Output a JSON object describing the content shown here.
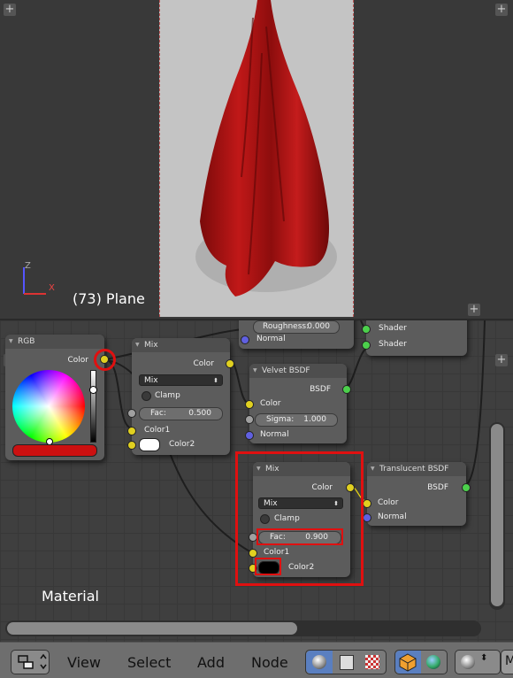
{
  "viewport": {
    "object_label": "(73) Plane",
    "axis_z": "Z",
    "axis_x": "X"
  },
  "node_editor": {
    "editor_label": "Material",
    "partial_node": {
      "roughness_label": "Roughness:",
      "roughness_value": "0.000",
      "normal": "Normal"
    },
    "mix_shader_outputs": [
      "Shader",
      "Shader"
    ],
    "rgb_node": {
      "title": "RGB",
      "output": "Color",
      "swatch_color": "#cc1010"
    },
    "mix1": {
      "title": "Mix",
      "output": "Color",
      "blend_mode": "Mix",
      "clamp": "Clamp",
      "fac_label": "Fac:",
      "fac_value": "0.500",
      "color1": "Color1",
      "color2": "Color2"
    },
    "velvet": {
      "title": "Velvet BSDF",
      "output": "BSDF",
      "color": "Color",
      "sigma_label": "Sigma:",
      "sigma_value": "1.000",
      "normal": "Normal"
    },
    "mix2": {
      "title": "Mix",
      "output": "Color",
      "blend_mode": "Mix",
      "clamp": "Clamp",
      "fac_label": "Fac:",
      "fac_value": "0.900",
      "color1": "Color1",
      "color2": "Color2"
    },
    "translucent": {
      "title": "Translucent BSDF",
      "output": "BSDF",
      "color": "Color",
      "normal": "Normal"
    }
  },
  "header": {
    "menus": [
      "View",
      "Select",
      "Add",
      "Node"
    ],
    "partial_label": "M"
  },
  "colors": {
    "highlight": "#e01010",
    "red_cloth": "#b01515"
  }
}
